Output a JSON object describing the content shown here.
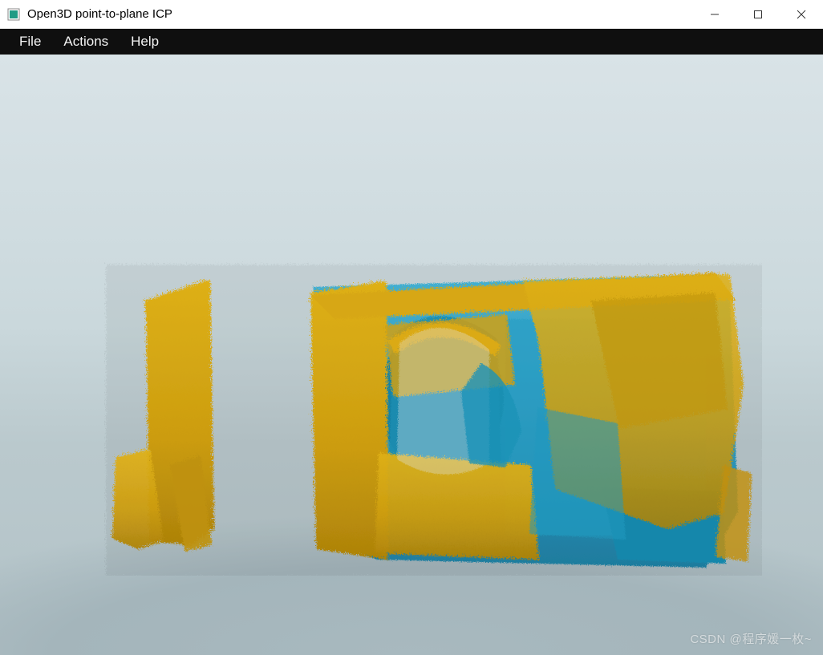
{
  "window": {
    "title": "Open3D point-to-plane ICP"
  },
  "menu": {
    "file": "File",
    "actions": "Actions",
    "help": "Help"
  },
  "viewport": {
    "scene_description": "3D point cloud registration visualization - two overlapping scans (yellow source, cyan target)"
  },
  "colors": {
    "source_cloud": "#d6a81a",
    "target_cloud": "#2aa1c7",
    "menubar_bg": "#0f0f0f",
    "sky_top": "#d9e3e7",
    "sky_bottom": "#b3c3c8"
  },
  "watermark": "CSDN @程序媛一枚~"
}
